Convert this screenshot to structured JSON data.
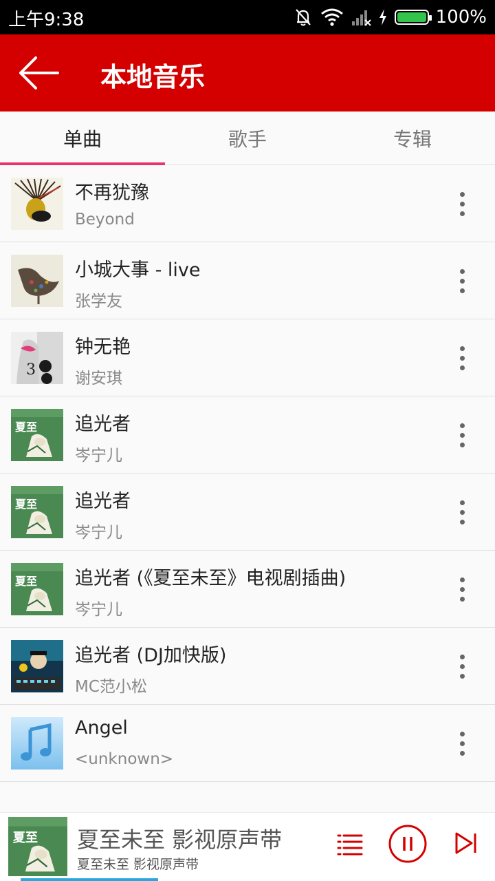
{
  "status_bar": {
    "time": "上午9:38",
    "battery": "100%",
    "icons": [
      "mute-bell-icon",
      "wifi-icon",
      "signal-icon",
      "charging-icon",
      "battery-icon"
    ]
  },
  "app_bar": {
    "title": "本地音乐",
    "back_icon": "arrow-left-icon",
    "color": "#d40000"
  },
  "tabs": [
    {
      "label": "单曲",
      "active": true
    },
    {
      "label": "歌手",
      "active": false
    },
    {
      "label": "专辑",
      "active": false
    }
  ],
  "accent": "#e8336b",
  "songs": [
    {
      "title": "不再犹豫",
      "artist": "Beyond",
      "art": "album-beyond"
    },
    {
      "title": "小城大事 - live",
      "artist": "张学友",
      "art": "album-bird"
    },
    {
      "title": "钟无艳",
      "artist": "谢安琪",
      "art": "album-face"
    },
    {
      "title": "追光者",
      "artist": "岑宁儿",
      "art": "album-green"
    },
    {
      "title": "追光者",
      "artist": "岑宁儿",
      "art": "album-green"
    },
    {
      "title": "追光者 (《夏至未至》电视剧插曲)",
      "artist": "岑宁儿",
      "art": "album-green"
    },
    {
      "title": "追光者 (DJ加快版)",
      "artist": "MC范小松",
      "art": "album-dj"
    },
    {
      "title": "Angel",
      "artist": "<unknown>",
      "art": "music-note-placeholder"
    }
  ],
  "player": {
    "title": "夏至未至 影视原声带",
    "subtitle": "夏至未至 影视原声带",
    "controls": [
      "playlist-icon",
      "pause-icon",
      "next-icon"
    ],
    "progress": 0.28
  }
}
